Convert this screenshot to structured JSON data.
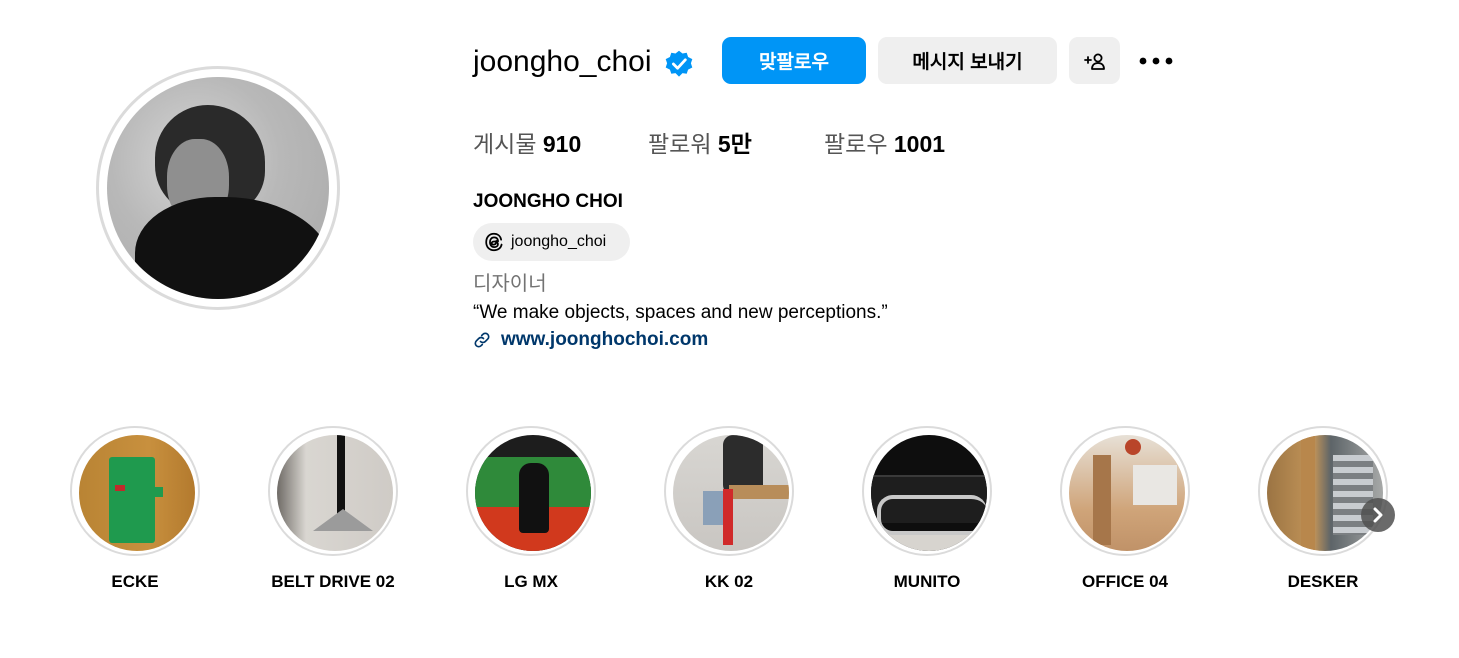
{
  "profile": {
    "username": "joongho_choi",
    "verified_icon": "verified-badge-icon",
    "full_name": "JOONGHO CHOI",
    "threads_handle": "joongho_choi",
    "category": "디자이너",
    "bio": "“We make objects, spaces and new perceptions.”",
    "website": "www.joonghochoi.com"
  },
  "actions": {
    "follow_back_label": "맞팔로우",
    "message_label": "메시지 보내기",
    "add_user_icon": "add-person-icon",
    "more_icon": "more-options-icon"
  },
  "stats": {
    "posts_label": "게시물",
    "posts_value": "910",
    "followers_label": "팔로워",
    "followers_value": "5만",
    "following_label": "팔로우",
    "following_value": "1001"
  },
  "highlights": [
    {
      "label": "ECKE"
    },
    {
      "label": "BELT DRIVE 02"
    },
    {
      "label": "LG MX"
    },
    {
      "label": "KK 02"
    },
    {
      "label": "MUNITO"
    },
    {
      "label": "OFFICE 04"
    },
    {
      "label": "DESKER"
    }
  ],
  "colors": {
    "accent": "#0095f6",
    "link": "#00376b",
    "button_gray": "#efefef"
  }
}
